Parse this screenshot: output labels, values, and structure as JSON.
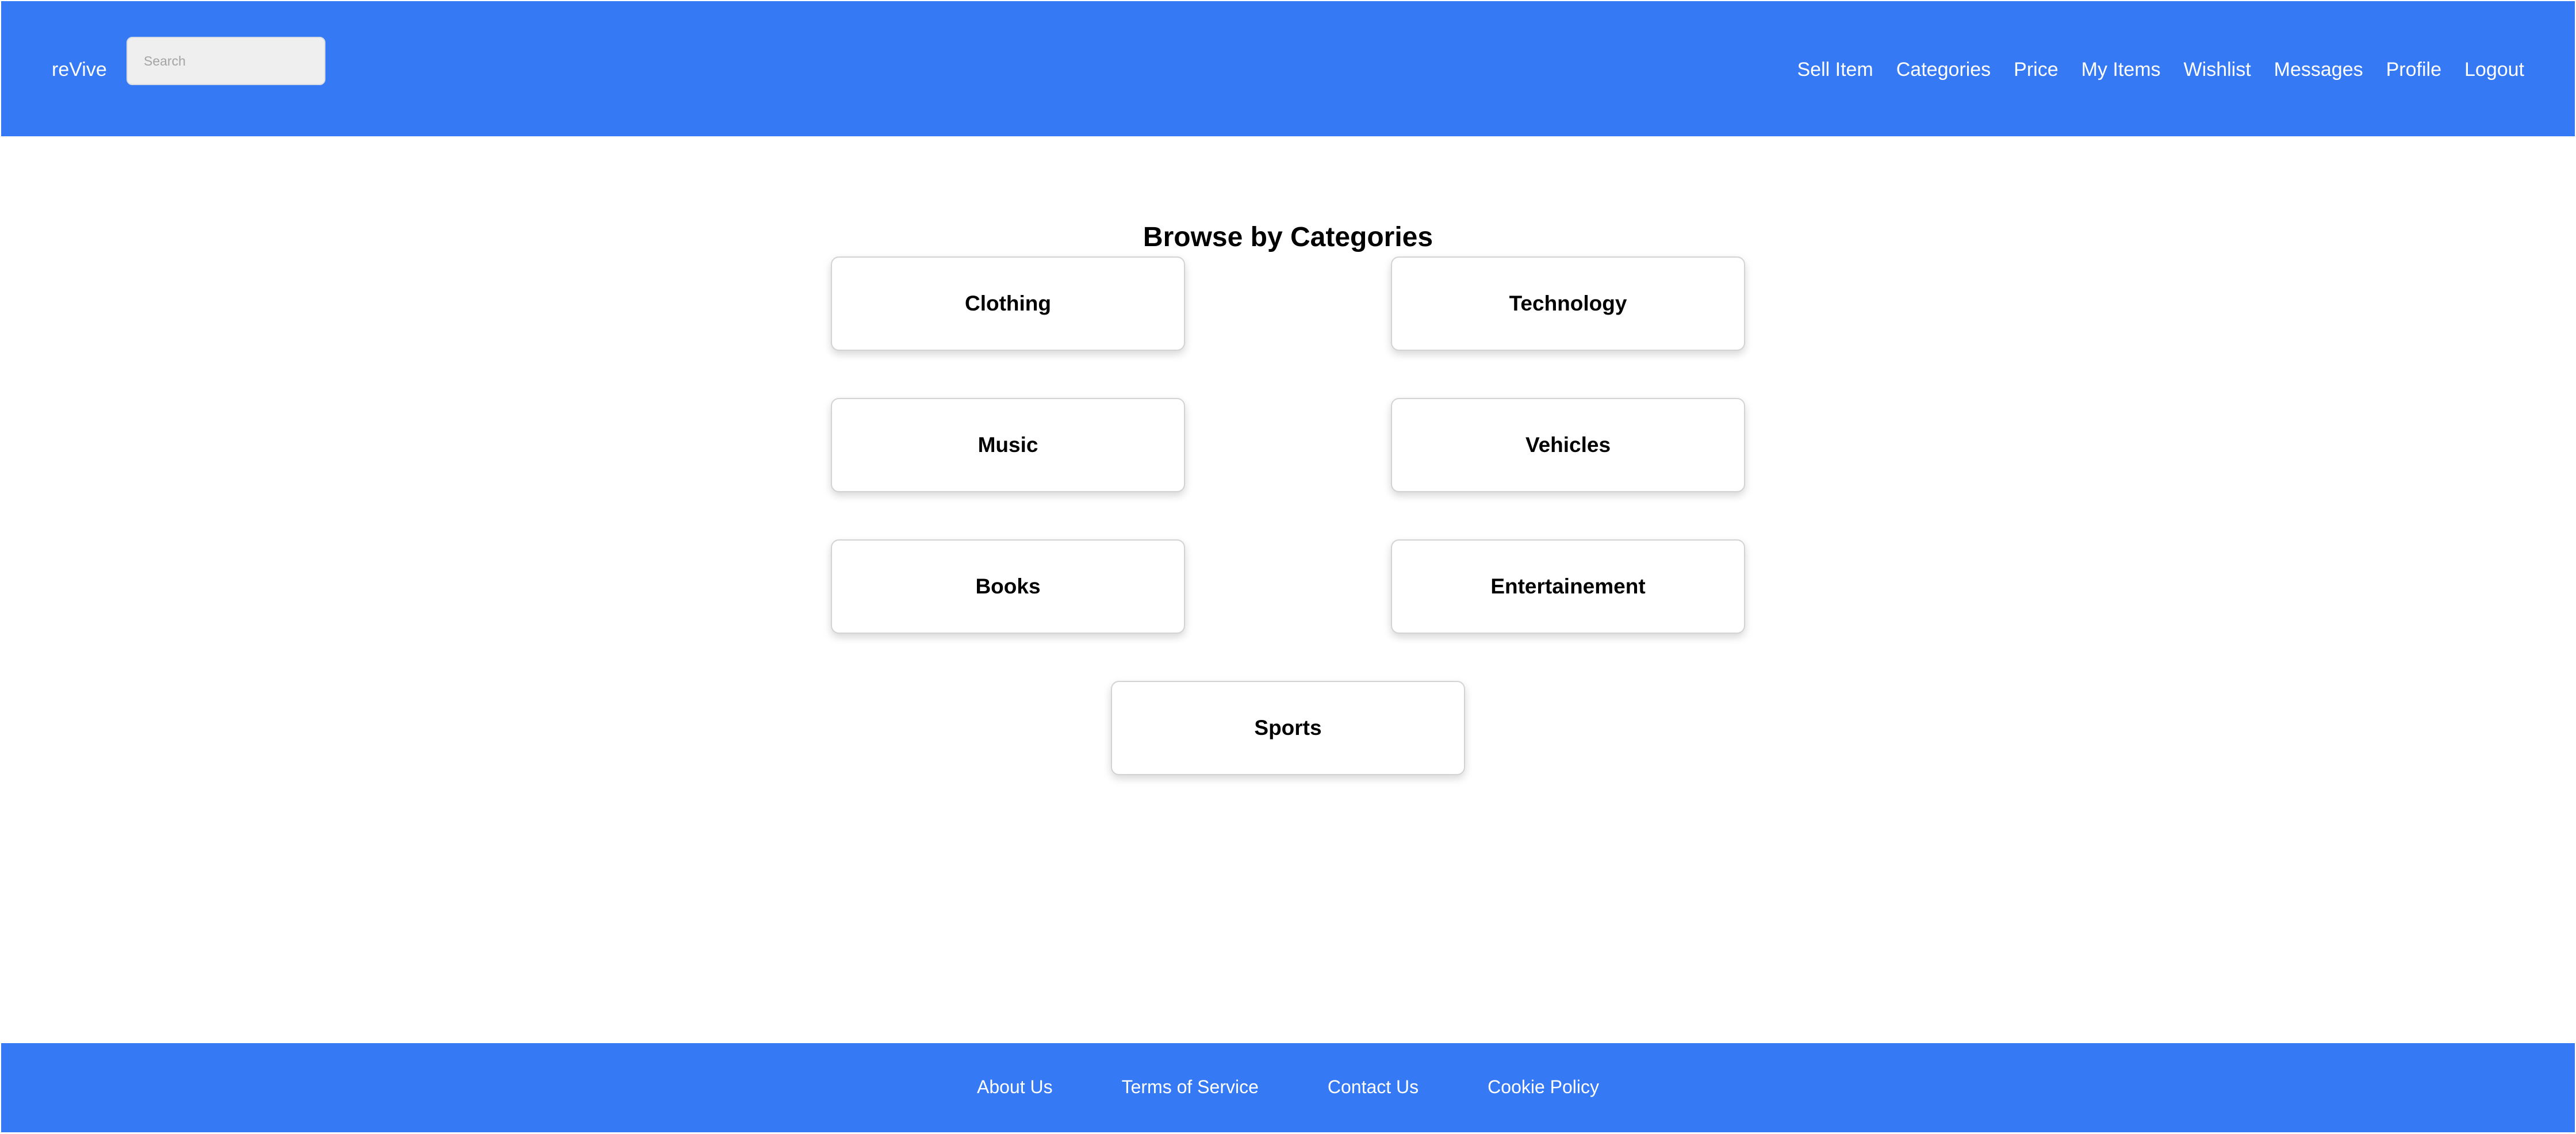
{
  "header": {
    "brand": "reVive",
    "search_placeholder": "Search",
    "nav": [
      "Sell Item",
      "Categories",
      "Price",
      "My Items",
      "Wishlist",
      "Messages",
      "Profile",
      "Logout"
    ]
  },
  "main": {
    "title": "Browse by Categories",
    "categories": [
      "Clothing",
      "Technology",
      "Music",
      "Vehicles",
      "Books",
      "Entertainement",
      "Sports"
    ]
  },
  "footer": {
    "links": [
      "About Us",
      "Terms of Service",
      "Contact Us",
      "Cookie Policy"
    ]
  },
  "colors": {
    "brand_blue": "#3679F5",
    "background": "#FFFFFF",
    "card_border": "#D3D3D3",
    "search_background": "#EFEFEF"
  }
}
